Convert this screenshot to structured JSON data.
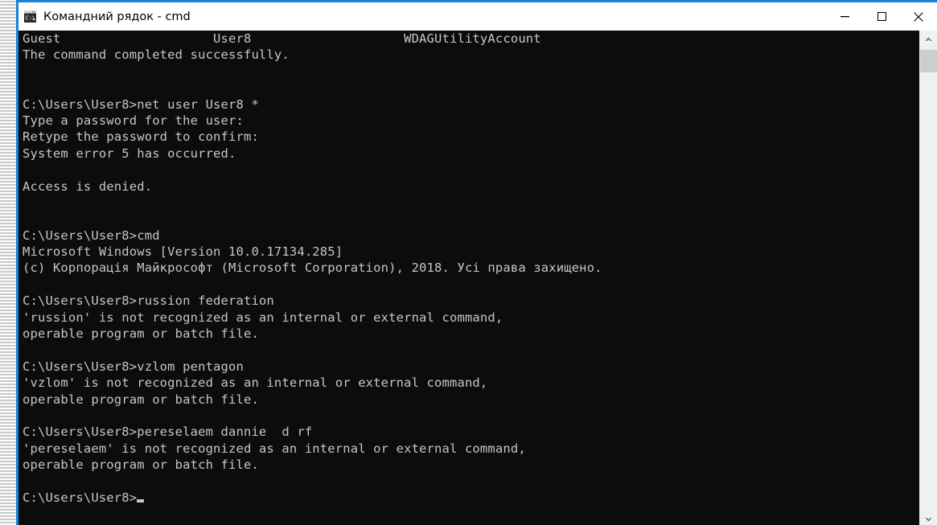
{
  "window": {
    "title": "Командний рядок - cmd",
    "icon": "cmd-console-icon",
    "accent_color": "#1683d8",
    "titlebar_bg": "#ffffff",
    "console_bg": "#0c0c0c",
    "console_fg": "#c6c6c6",
    "controls": {
      "minimize_label": "Minimize",
      "maximize_label": "Maximize",
      "close_label": "Close"
    }
  },
  "console": {
    "lines": [
      "Guest                    User8                    WDAGUtilityAccount",
      "The command completed successfully.",
      "",
      "",
      "C:\\Users\\User8>net user User8 *",
      "Type a password for the user:",
      "Retype the password to confirm:",
      "System error 5 has occurred.",
      "",
      "Access is denied.",
      "",
      "",
      "C:\\Users\\User8>cmd",
      "Microsoft Windows [Version 10.0.17134.285]",
      "(c) Корпорація Майкрософт (Microsoft Corporation), 2018. Усі права захищено.",
      "",
      "C:\\Users\\User8>russion federation",
      "'russion' is not recognized as an internal or external command,",
      "operable program or batch file.",
      "",
      "C:\\Users\\User8>vzlom pentagon",
      "'vzlom' is not recognized as an internal or external command,",
      "operable program or batch file.",
      "",
      "C:\\Users\\User8>pereselaem dannie  d rf",
      "'pereselaem' is not recognized as an internal or external command,",
      "operable program or batch file.",
      ""
    ],
    "prompt_last": "C:\\Users\\User8>",
    "cursor": "block-cursor"
  },
  "scrollbar": {
    "up_arrow": "chevron-up-icon",
    "down_arrow": "chevron-down-icon",
    "thumb_label": "scrollbar-thumb",
    "track_color": "#f0f0f0",
    "thumb_color": "#cdcdcd"
  }
}
